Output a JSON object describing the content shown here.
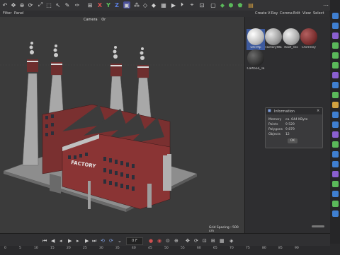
{
  "toolbar": {
    "axes": [
      "X",
      "Y",
      "Z"
    ],
    "accent": "#4a4f9a"
  },
  "view_menu": [
    "Filter",
    "Panel"
  ],
  "viewport": {
    "camera_label": "Camera",
    "camera_extra": "Or",
    "grid_spacing": "Grid Spacing : 500 cm",
    "building_sign": "FACTORY"
  },
  "material_menu": [
    "Create",
    "V-Ray",
    "Corona",
    "Edit",
    "View",
    "Select"
  ],
  "materials": [
    {
      "name": "SKFMp",
      "color": "#d8d8d8",
      "selected": true
    },
    {
      "name": "FactoryWa",
      "color": "#9a9a9a",
      "selected": false
    },
    {
      "name": "Roof_Tex",
      "color": "#b0b0b0",
      "selected": false
    },
    {
      "name": "Chimney",
      "color": "#7a2f2f",
      "selected": false
    },
    {
      "name": "Cartoon_Te",
      "color": "#3a3a3a",
      "selected": false
    }
  ],
  "info_dialog": {
    "title": "Information",
    "rows": [
      {
        "label": "Memory",
        "value": "ca. 644 KByte"
      },
      {
        "label": "Points",
        "value": "9 529"
      },
      {
        "label": "Polygons",
        "value": "9 879"
      },
      {
        "label": "Objects",
        "value": "12"
      }
    ],
    "ok_label": "OK"
  },
  "timeline": {
    "frame_value": "0 F",
    "ticks": [
      "0",
      "5",
      "10",
      "15",
      "20",
      "25",
      "30",
      "35",
      "40",
      "45",
      "50",
      "55",
      "60",
      "65",
      "70",
      "75",
      "80",
      "85",
      "90"
    ]
  }
}
